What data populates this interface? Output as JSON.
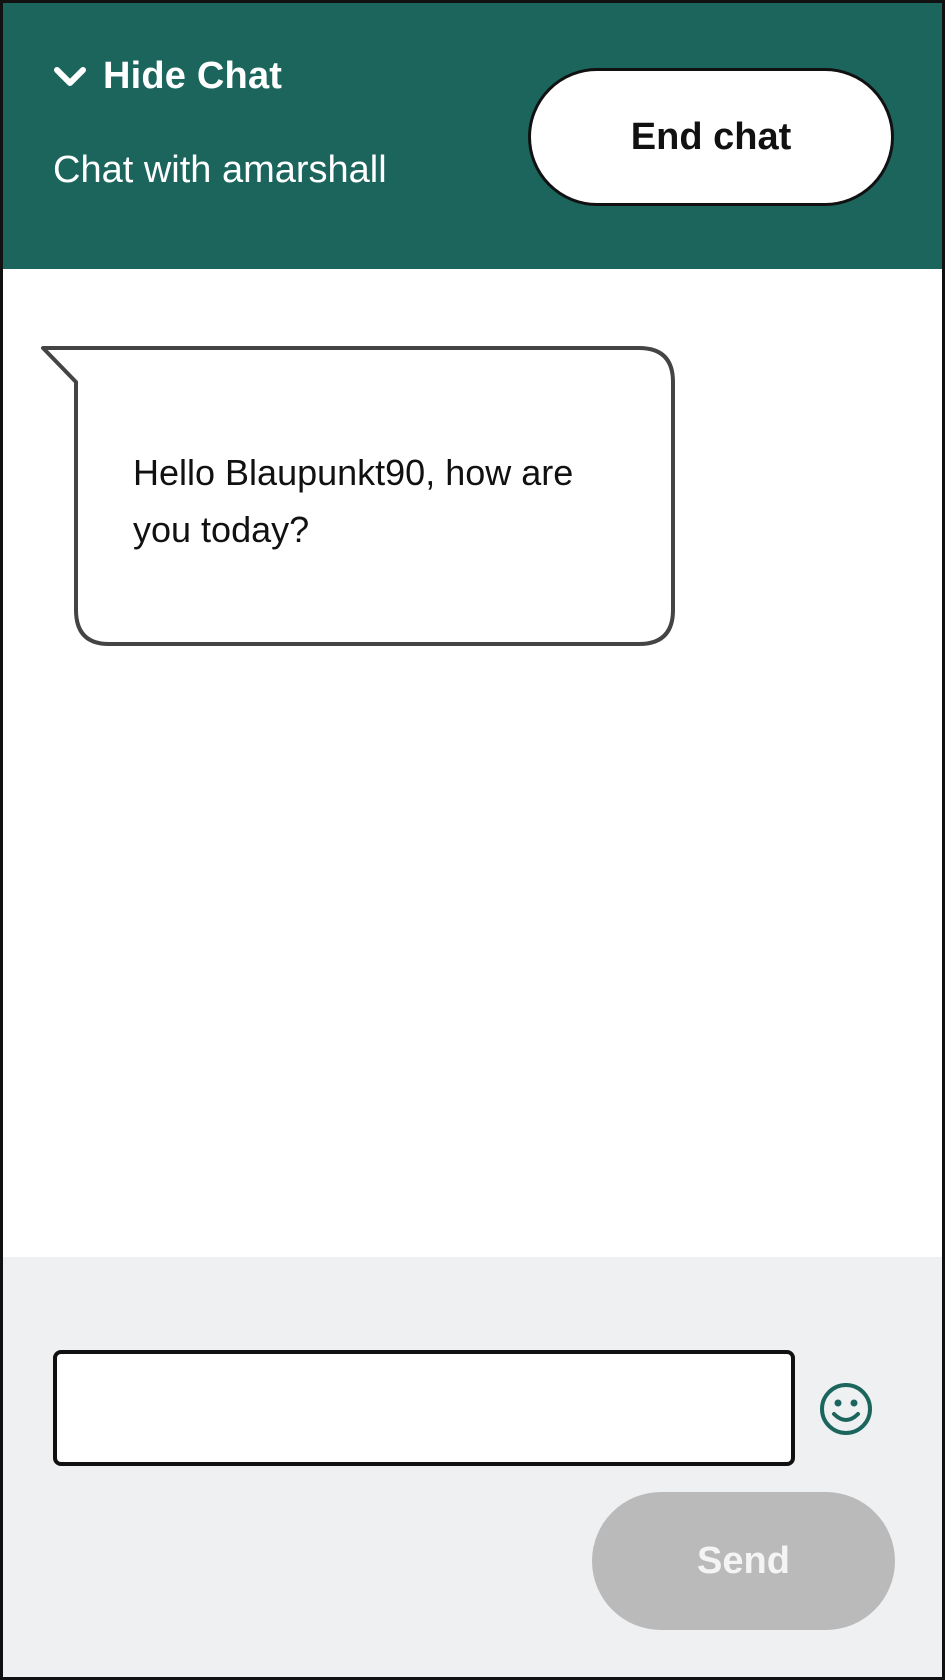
{
  "header": {
    "hide_chat_label": "Hide Chat",
    "hide_chat_icon": "chevron-down-icon",
    "chat_with": "Chat with amarshall",
    "end_chat_label": "End chat",
    "background_color": "#1b655d"
  },
  "transcript": {
    "messages": [
      {
        "sender": "agent",
        "text": "Hello Blaupunkt90, how are you today?"
      }
    ]
  },
  "composer": {
    "input_value": "",
    "input_placeholder": "",
    "emoji_icon": "smiley-face-icon",
    "send_label": "Send",
    "send_enabled": false
  }
}
